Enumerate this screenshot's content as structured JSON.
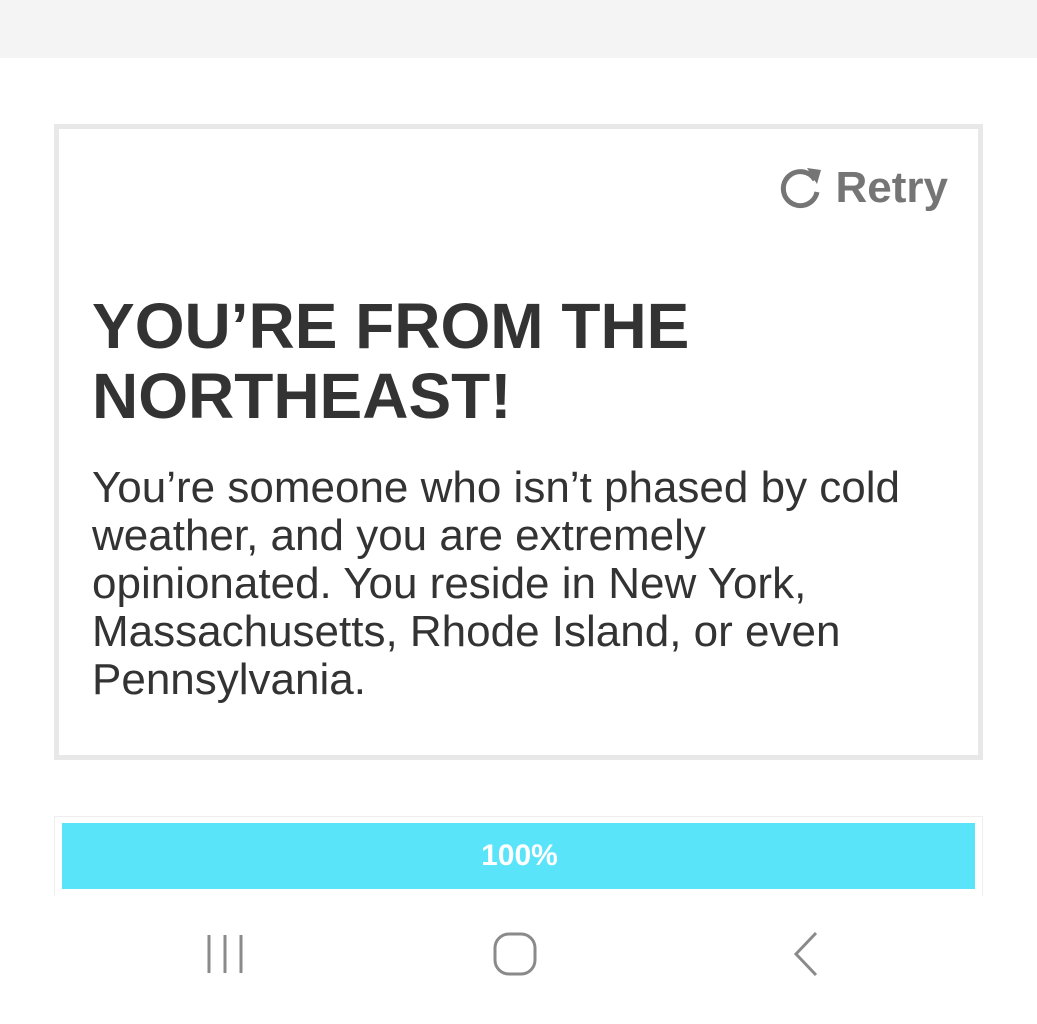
{
  "result": {
    "retry_label": "Retry",
    "title": "YOU’RE FROM THE NORTHEAST!",
    "description": "You’re someone who isn’t phased by cold weather, and you are extremely opinionated. You reside in New York, Massachusetts, Rhode Island, or even Pennsylvania."
  },
  "progress": {
    "percent": 100,
    "label": "100%",
    "color": "#5ae4fa"
  },
  "icons": {
    "retry": "refresh-icon",
    "recent_apps": "recent-apps-icon",
    "home": "home-icon",
    "back": "back-icon"
  }
}
